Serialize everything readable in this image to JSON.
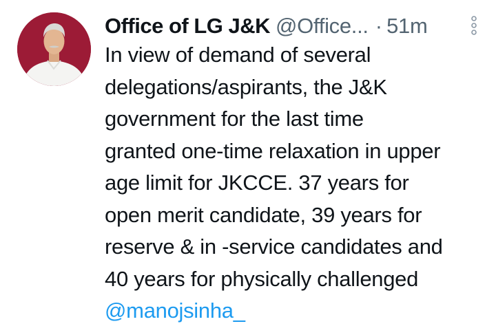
{
  "tweet": {
    "author": {
      "display_name": "Office of LG J&K",
      "handle": "@Office...",
      "avatar_icon": "profile-photo"
    },
    "separator": "·",
    "timestamp": "51m",
    "more_icon": "more-vertical-icon",
    "body_lines": [
      "In view of demand of several",
      "delegations/aspirants, the J&K",
      "government for the last time",
      "granted one-time relaxation in upper",
      "age limit for JKCCE. 37 years for",
      "open merit candidate, 39 years for",
      "reserve & in -service candidates and",
      "40 years for physically challenged"
    ],
    "mention": "@manojsinha_"
  },
  "colors": {
    "text": "#0f1419",
    "secondary": "#536471",
    "link": "#1d9bf0",
    "avatar_bg": "#9c1b36"
  }
}
